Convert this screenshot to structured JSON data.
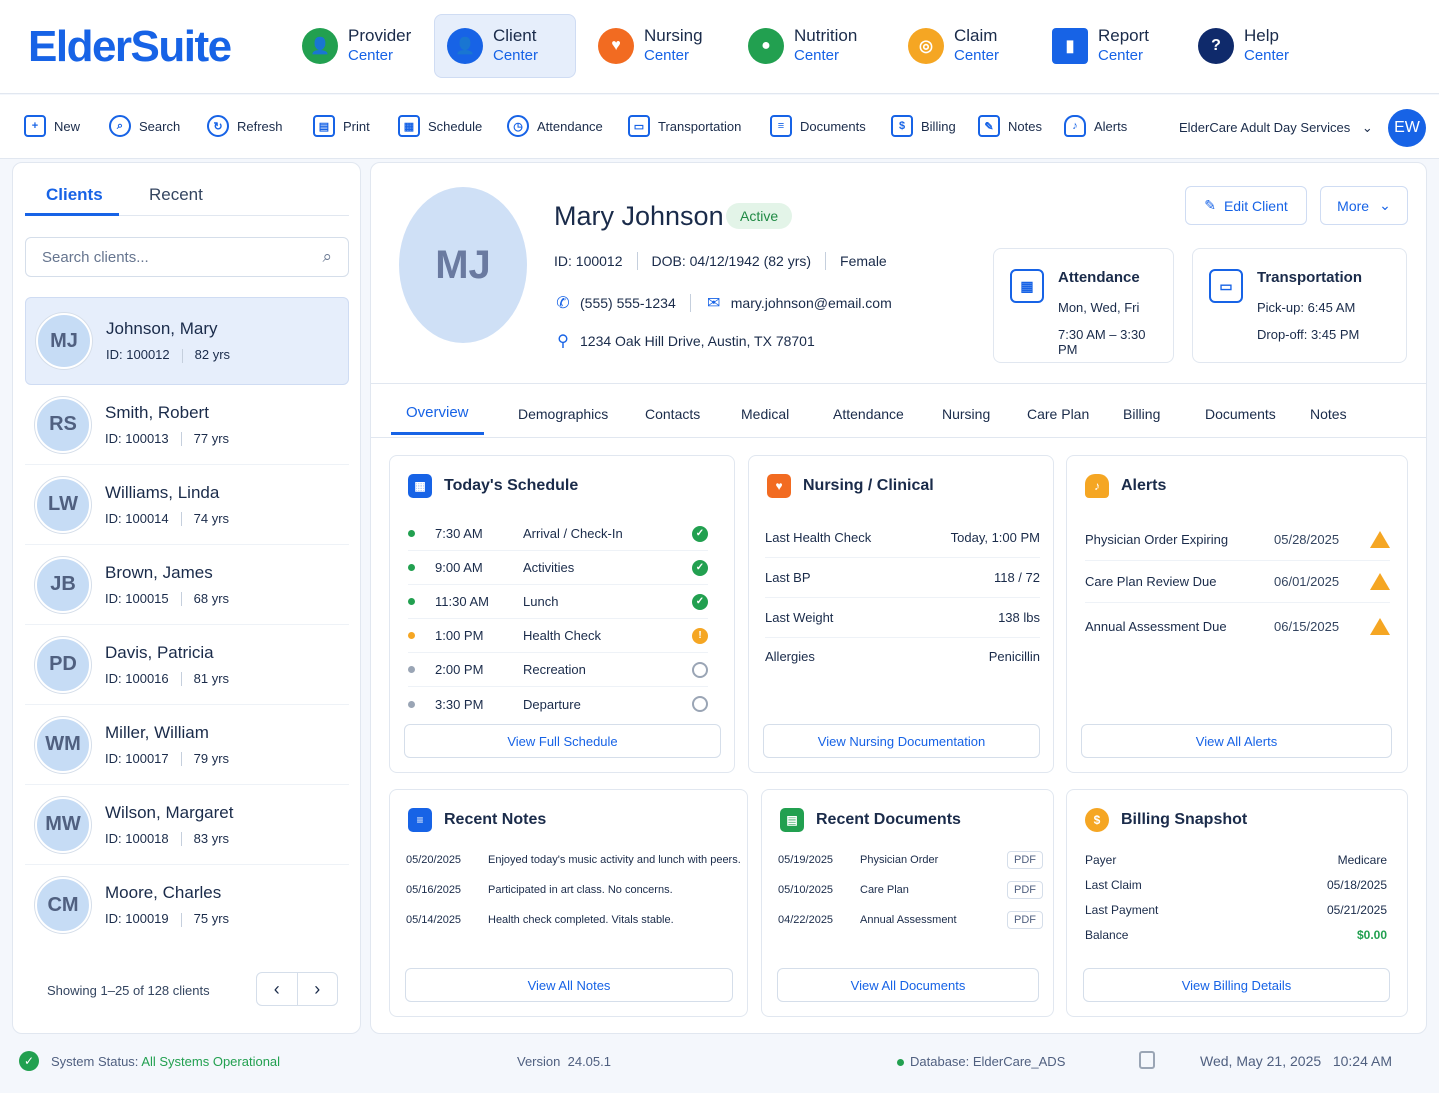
{
  "app": {
    "logo": "ElderSuite"
  },
  "modules": [
    {
      "title": "Provider",
      "sub": "Center",
      "icon": "provider-icon",
      "color": "#22a050"
    },
    {
      "title": "Client",
      "sub": "Center",
      "icon": "client-icon",
      "color": "#1763e6"
    },
    {
      "title": "Nursing",
      "sub": "Center",
      "icon": "nursing-icon",
      "color": "#f26b21"
    },
    {
      "title": "Nutrition",
      "sub": "Center",
      "icon": "apple-icon",
      "color": "#22a050"
    },
    {
      "title": "Claim",
      "sub": "Center",
      "icon": "claim-icon",
      "color": "#f5a623"
    },
    {
      "title": "Report",
      "sub": "Center",
      "icon": "bar-chart-icon",
      "color": "#1763e6"
    },
    {
      "title": "Help",
      "sub": "Center",
      "icon": "help-icon",
      "color": "#0f2a6b"
    }
  ],
  "toolbar": {
    "items": [
      "New",
      "Search",
      "Refresh",
      "Print",
      "Schedule",
      "Attendance",
      "Transportation",
      "Documents",
      "Billing",
      "Notes",
      "Alerts"
    ],
    "org": "ElderCare Adult Day Services",
    "user_initials": "EW"
  },
  "left": {
    "tab_clients": "Clients",
    "tab_recent": "Recent",
    "search_placeholder": "Search clients...",
    "id_label": "ID:",
    "clients": [
      {
        "name": "Johnson, Mary",
        "id": "100012",
        "age": "82 yrs",
        "initials": "MJ"
      },
      {
        "name": "Smith, Robert",
        "id": "100013",
        "age": "77 yrs",
        "initials": "RS"
      },
      {
        "name": "Williams, Linda",
        "id": "100014",
        "age": "74 yrs",
        "initials": "LW"
      },
      {
        "name": "Brown, James",
        "id": "100015",
        "age": "68 yrs",
        "initials": "JB"
      },
      {
        "name": "Davis, Patricia",
        "id": "100016",
        "age": "81 yrs",
        "initials": "PD"
      },
      {
        "name": "Miller, William",
        "id": "100017",
        "age": "79 yrs",
        "initials": "WM"
      },
      {
        "name": "Wilson, Margaret",
        "id": "100018",
        "age": "83 yrs",
        "initials": "MW"
      },
      {
        "name": "Moore, Charles",
        "id": "100019",
        "age": "75 yrs",
        "initials": "CM"
      }
    ],
    "showing": "Showing 1–25 of 128 clients"
  },
  "profile": {
    "name": "Mary Johnson",
    "status": "Active",
    "id": "ID:  100012",
    "dob": "DOB:  04/12/1942 (82 yrs)",
    "gender": "Female",
    "phone": "(555) 555-1234",
    "email": "mary.johnson@email.com",
    "address": "1234 Oak Hill Drive, Austin, TX 78701",
    "edit": "Edit Client",
    "more": "More",
    "photo_initials": "MJ"
  },
  "attendance_card": {
    "title": "Attendance",
    "days": "Mon, Wed, Fri",
    "hours": "7:30 AM – 3:30 PM"
  },
  "transport_card": {
    "title": "Transportation",
    "pickup": "Pick-up: 6:45 AM",
    "dropoff": "Drop-off:  3:45 PM"
  },
  "tabs": [
    "Overview",
    "Demographics",
    "Contacts",
    "Medical",
    "Attendance",
    "Nursing",
    "Care Plan",
    "Billing",
    "Documents",
    "Notes"
  ],
  "schedule": {
    "title": "Today's Schedule",
    "rows": [
      {
        "time": "7:30 AM",
        "activity": "Arrival / Check-In",
        "status": "done"
      },
      {
        "time": "9:00 AM",
        "activity": "Activities",
        "status": "done"
      },
      {
        "time": "11:30 AM",
        "activity": "Lunch",
        "status": "done"
      },
      {
        "time": "1:00 PM",
        "activity": "Health Check",
        "status": "pending"
      },
      {
        "time": "2:00 PM",
        "activity": "Recreation",
        "status": "upcoming"
      },
      {
        "time": "3:30 PM",
        "activity": "Departure",
        "status": "upcoming"
      }
    ],
    "button": "View Full Schedule"
  },
  "nursing": {
    "title": "Nursing / Clinical",
    "rows": [
      {
        "label": "Last Health Check",
        "value": "Today, 1:00 PM"
      },
      {
        "label": "Last BP",
        "value": "118 / 72"
      },
      {
        "label": "Last Weight",
        "value": "138 lbs"
      },
      {
        "label": "Allergies",
        "value": "Penicillin"
      }
    ],
    "button": "View Nursing Documentation"
  },
  "alerts": {
    "title": "Alerts",
    "rows": [
      {
        "label": "Physician Order Expiring",
        "date": "05/28/2025"
      },
      {
        "label": "Care Plan Review Due",
        "date": "06/01/2025"
      },
      {
        "label": "Annual Assessment Due",
        "date": "06/15/2025"
      }
    ],
    "button": "View All Alerts"
  },
  "notes": {
    "title": "Recent Notes",
    "rows": [
      {
        "date": "05/20/2025",
        "text": "Enjoyed today's music activity and lunch with peers."
      },
      {
        "date": "05/16/2025",
        "text": "Participated in art class. No concerns."
      },
      {
        "date": "05/14/2025",
        "text": "Health check completed. Vitals stable."
      }
    ],
    "button": "View All Notes"
  },
  "documents": {
    "title": "Recent Documents",
    "rows": [
      {
        "date": "05/19/2025",
        "name": "Physician Order",
        "type": "PDF"
      },
      {
        "date": "05/10/2025",
        "name": "Care Plan",
        "type": "PDF"
      },
      {
        "date": "04/22/2025",
        "name": "Annual Assessment",
        "type": "PDF"
      }
    ],
    "button": "View All Documents"
  },
  "billing": {
    "title": "Billing Snapshot",
    "rows": [
      {
        "label": "Payer",
        "value": "Medicare"
      },
      {
        "label": "Last Claim",
        "value": "05/18/2025"
      },
      {
        "label": "Last Payment",
        "value": "05/21/2025"
      },
      {
        "label": "Balance",
        "value": "$0.00"
      }
    ],
    "button": "View Billing Details"
  },
  "footer": {
    "status_label": "System Status:",
    "status_value": "All Systems Operational",
    "version_label": "Version",
    "version": "24.05.1",
    "database": "Database: ElderCare_ADS",
    "date": "Wed, May 21, 2025",
    "time": "10:24 AM"
  }
}
